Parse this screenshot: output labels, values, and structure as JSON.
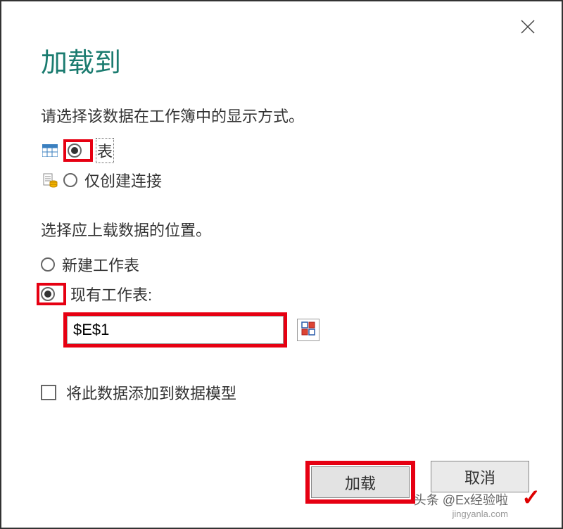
{
  "dialog": {
    "title": "加载到",
    "close_aria": "Close"
  },
  "display_mode": {
    "prompt": "请选择该数据在工作簿中的显示方式。",
    "option_table": "表",
    "option_connection_only": "仅创建连接"
  },
  "load_location": {
    "prompt": "选择应上载数据的位置。",
    "option_new_sheet": "新建工作表",
    "option_existing_sheet": "现有工作表:",
    "cell_ref": "$E$1"
  },
  "data_model": {
    "checkbox_label": "将此数据添加到数据模型"
  },
  "buttons": {
    "load": "加载",
    "cancel": "取消"
  },
  "watermark": {
    "line1": "头条 @Ex经验啦",
    "line2": "jingyanla.com"
  },
  "highlight_color": "#e60012"
}
